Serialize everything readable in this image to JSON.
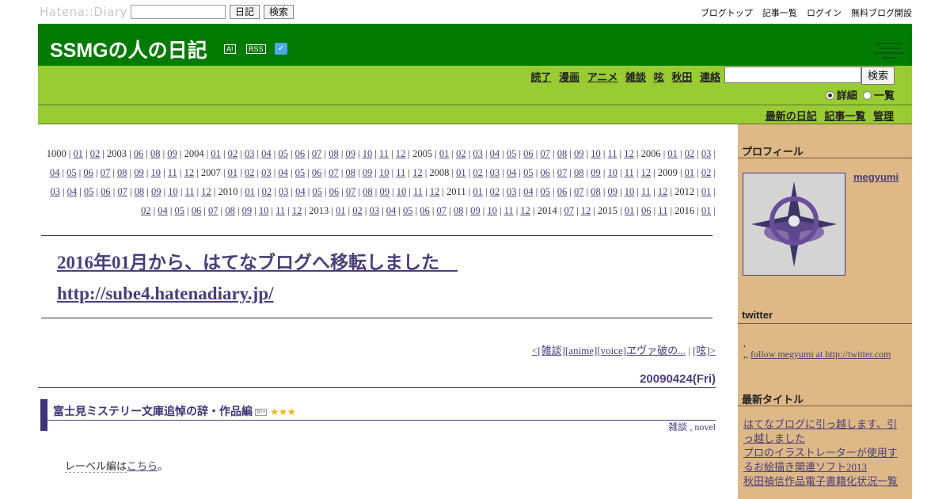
{
  "topbar": {
    "logo": "Hatena::Diary",
    "diary_button": "日記",
    "search_button": "検索",
    "links": [
      "ブログトップ",
      "記事一覧",
      "ログイン",
      "無料ブログ開設"
    ]
  },
  "header": {
    "title": "SSMGの人の日記",
    "icon_a": "A!",
    "icon_rss": "RSS"
  },
  "nav": {
    "categories": [
      "読了",
      "漫画",
      "アニメ",
      "雑談",
      "呟",
      "秋田",
      "連絡"
    ],
    "search_button": "検索",
    "radio_detail": "詳細",
    "radio_list": "一覧",
    "sublinks": [
      "最新の日記",
      "記事一覧",
      "管理"
    ]
  },
  "calendar": [
    {
      "year": "1000",
      "months": [
        "01",
        "02"
      ]
    },
    {
      "year": "2003",
      "months": [
        "06",
        "08",
        "09"
      ]
    },
    {
      "year": "2004",
      "months": [
        "01",
        "02",
        "03",
        "04",
        "05",
        "06",
        "07",
        "08",
        "09",
        "10",
        "11",
        "12"
      ]
    },
    {
      "year": "2005",
      "months": [
        "01",
        "02",
        "03",
        "04",
        "05",
        "06",
        "07",
        "08",
        "09",
        "10",
        "11",
        "12"
      ]
    },
    {
      "year": "2006",
      "months": [
        "01",
        "02",
        "03",
        "04",
        "05",
        "06",
        "07",
        "08",
        "09",
        "10",
        "11",
        "12"
      ]
    },
    {
      "year": "2007",
      "months": [
        "01",
        "02",
        "03",
        "04",
        "05",
        "06",
        "07",
        "08",
        "09",
        "10",
        "11",
        "12"
      ]
    },
    {
      "year": "2008",
      "months": [
        "01",
        "02",
        "03",
        "04",
        "05",
        "06",
        "07",
        "08",
        "09",
        "10",
        "11",
        "12"
      ]
    },
    {
      "year": "2009",
      "months": [
        "01",
        "02",
        "03",
        "04",
        "05",
        "06",
        "07",
        "08",
        "09",
        "10",
        "11",
        "12"
      ]
    },
    {
      "year": "2010",
      "months": [
        "01",
        "02",
        "03",
        "04",
        "05",
        "06",
        "07",
        "08",
        "09",
        "10",
        "11",
        "12"
      ]
    },
    {
      "year": "2011",
      "months": [
        "01",
        "02",
        "03",
        "04",
        "05",
        "06",
        "07",
        "08",
        "09",
        "10",
        "11",
        "12"
      ]
    },
    {
      "year": "2012",
      "months": [
        "01",
        "02",
        "04",
        "05",
        "06",
        "07",
        "08",
        "09",
        "10",
        "11",
        "12"
      ]
    },
    {
      "year": "2013",
      "months": [
        "01",
        "02",
        "03",
        "04",
        "05",
        "06",
        "07",
        "08",
        "09",
        "10",
        "11",
        "12"
      ]
    },
    {
      "year": "2014",
      "months": [
        "07",
        "12"
      ]
    },
    {
      "year": "2015",
      "months": [
        "01",
        "06",
        "11"
      ]
    },
    {
      "year": "2016",
      "months": [
        "01"
      ]
    }
  ],
  "notice": {
    "line1": "2016年01月から、はてなブログへ移転しました　",
    "line2": "http://sube4.hatenadiary.jp/"
  },
  "pager": {
    "prev": "<[雑談][anime][voice]ヱヴァ破の...",
    "sep": "|",
    "next": "[呟]>"
  },
  "entry": {
    "date": "20090424(Fri)",
    "title": "富士見ミステリー文庫追悼の辞・作品編",
    "bookmark": "B!+",
    "stars": "★★★",
    "tags": "雑談 , novel",
    "body_prefix": "レーベル編は",
    "body_link": "こちら",
    "body_suffix": "。"
  },
  "sidebar": {
    "profile_heading": "プロフィール",
    "username": "megyumi",
    "twitter_heading": "twitter",
    "twitter_line1": ",",
    "twitter_line2_prefix": ",, ",
    "twitter_link": "follow megyumi at http://twitter.com",
    "recent_heading": "最新タイトル",
    "recent_items": [
      "はてなブログに引っ越します、引っ越しました",
      "プロのイラストレーターが使用するお絵描き関連ソフト2013",
      "秋田禎信作品電子書籍化状況一覧"
    ]
  },
  "colors": {
    "header_green": "#007a00",
    "nav_green": "#99cc33",
    "sidebar_tan": "#deb887",
    "link_purple": "#4a3e7a"
  }
}
